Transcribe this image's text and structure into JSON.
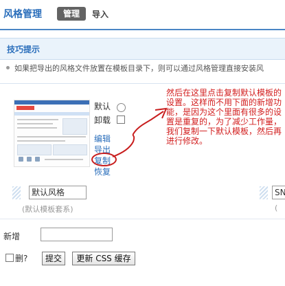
{
  "header": {
    "title": "风格管理",
    "tabs": [
      {
        "label": "管理",
        "active": true
      },
      {
        "label": "导入",
        "active": false
      }
    ]
  },
  "tips": {
    "heading": "技巧提示",
    "text": "如果把导出的风格文件放置在模板目录下，则可以通过风格管理直接安装风"
  },
  "style_item": {
    "default_label": "默认",
    "uninstall_label": "卸载",
    "actions": {
      "edit": "编辑",
      "export": "导出",
      "copy": "复制",
      "restore": "恢复"
    },
    "name_value": "默认风格",
    "caption": "(默认模板套系)"
  },
  "style_item_2": {
    "name_value": "SN",
    "caption": "("
  },
  "annotation": {
    "note": "然后在这里点击复制默认模板的设置。这样而不用下面的新增功能，是因为这个里面有很多的设置是重复的，为了减少工作量，我们复制一下默认模板，然后再进行修改。",
    "color": "#d21e1e"
  },
  "form": {
    "add_label": "新增",
    "delete_label": "删?",
    "submit_label": "提交",
    "refresh_label": "更新 CSS 缓存"
  },
  "colors": {
    "accent": "#2a6ebb",
    "tab_active_bg": "#636363",
    "tips_bg": "#eaf3fb",
    "annotation_red": "#d21e1e"
  }
}
